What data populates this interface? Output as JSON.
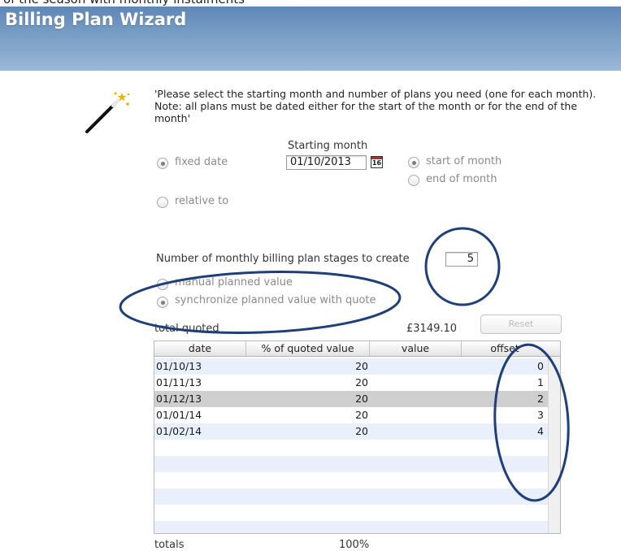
{
  "top_strip_text": "of the season with monthly instalments",
  "window": {
    "title": "Billing Plan Wizard"
  },
  "wizard": {
    "instructions": "'Please select the starting month and number of plans you need (one for each month). Note: all plans must be dated either for the start of the month or for the end of the month'"
  },
  "date_options": {
    "fixed_date_label": "fixed date",
    "relative_to_label": "relative to",
    "selected": "fixed date"
  },
  "starting_month": {
    "label": "Starting month",
    "value": "01/10/2013",
    "calendar_icon_text": "16"
  },
  "month_position": {
    "start_label": "start of month",
    "end_label": "end of month",
    "selected": "start of month"
  },
  "stages": {
    "label": "Number of monthly billing plan stages to create",
    "value": "5"
  },
  "value_mode": {
    "manual_label": "manual planned value",
    "sync_label": "synchronize planned value with quote",
    "selected": "synchronize planned value with quote"
  },
  "total_quoted": {
    "label": "total quoted",
    "value": "£3149.10"
  },
  "reset_button": {
    "label": "Reset"
  },
  "table": {
    "columns": [
      "date",
      "% of quoted value",
      "value",
      "offset"
    ],
    "rows": [
      {
        "date": "01/10/13",
        "percent": "20",
        "value": "",
        "offset": "0"
      },
      {
        "date": "01/11/13",
        "percent": "20",
        "value": "",
        "offset": "1"
      },
      {
        "date": "01/12/13",
        "percent": "20",
        "value": "",
        "offset": "2"
      },
      {
        "date": "01/01/14",
        "percent": "20",
        "value": "",
        "offset": "3"
      },
      {
        "date": "01/02/14",
        "percent": "20",
        "value": "",
        "offset": "4"
      }
    ],
    "selected_row": 2
  },
  "totals": {
    "label": "totals",
    "percent": "100%"
  },
  "colors": {
    "header_gradient_top": "#5f87b5",
    "header_gradient_bottom": "#9bb8d8",
    "annotation": "#1f3f7a",
    "row_stripe": "#e9f0fb",
    "row_selected": "#cfcfcf"
  },
  "icons": {
    "wand": "magic-wand-icon",
    "calendar": "calendar-icon"
  }
}
